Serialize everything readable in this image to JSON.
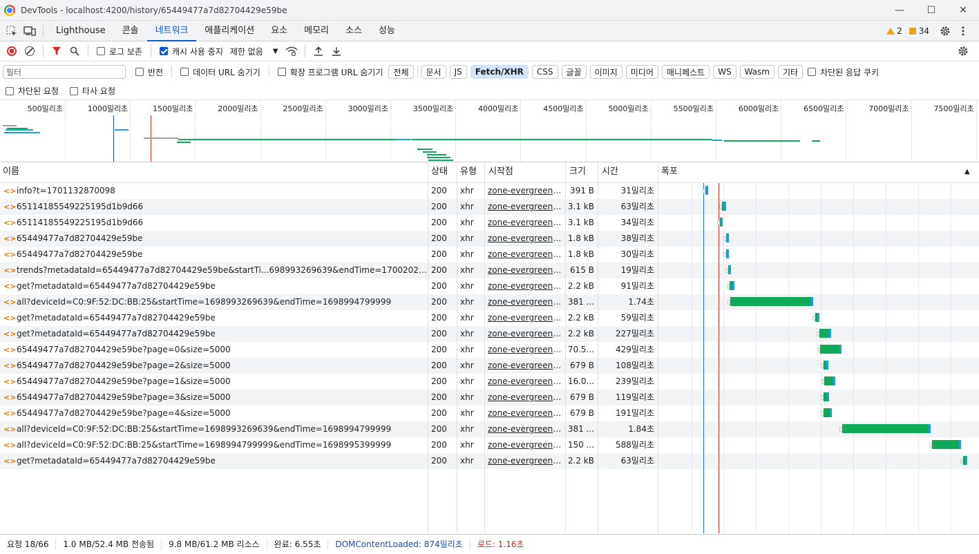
{
  "window": {
    "title": "DevTools - localhost:4200/history/65449477a7d82704429e59be",
    "minimize": "—",
    "maximize": "☐",
    "close": "✕"
  },
  "tabs": [
    {
      "label": "Lighthouse"
    },
    {
      "label": "콘솔"
    },
    {
      "label": "네트워크",
      "active": true
    },
    {
      "label": "애플리케이션"
    },
    {
      "label": "요소"
    },
    {
      "label": "메모리"
    },
    {
      "label": "소스"
    },
    {
      "label": "성능"
    }
  ],
  "counters": {
    "warnings": "2",
    "messages": "34"
  },
  "toolbar": {
    "preserve_log": "로그 보존",
    "disable_cache": "캐시 사용 중지",
    "throttle": "제한 없음"
  },
  "filter": {
    "placeholder": "필터",
    "invert": "반전",
    "hide_data_urls": "데이터 URL 숨기기",
    "hide_ext_urls": "확장 프로그램 URL 숨기기",
    "types": [
      "전체",
      "문서",
      "JS",
      "Fetch/XHR",
      "CSS",
      "글꼴",
      "이미지",
      "미디어",
      "매니페스트",
      "WS",
      "Wasm",
      "기타"
    ],
    "active_type": "Fetch/XHR",
    "blocked_cookies": "차단된 응답 쿠키",
    "blocked_requests": "차단된 요청",
    "third_party": "타사 요청"
  },
  "overview": {
    "ticks": [
      "500밀리초",
      "1000밀리초",
      "1500밀리초",
      "2000밀리초",
      "2500밀리초",
      "3000밀리초",
      "3500밀리초",
      "4000밀리초",
      "4500밀리초",
      "5000밀리초",
      "5500밀리초",
      "6000밀리초",
      "6500밀리초",
      "7000밀리초",
      "7500밀리초"
    ]
  },
  "columns": {
    "name": "이름",
    "status": "상태",
    "type": "유형",
    "initiator": "시작점",
    "size": "크기",
    "time": "시간",
    "waterfall": "폭포"
  },
  "rows": [
    {
      "name": "info?t=1701132870098",
      "status": "200",
      "type": "xhr",
      "initiator": "zone-evergreen.j...",
      "size": "391 B",
      "time": "31밀리초"
    },
    {
      "name": "65114185549225195d1b9d66",
      "status": "200",
      "type": "xhr",
      "initiator": "zone-evergreen.j...",
      "size": "3.1 kB",
      "time": "63밀리초"
    },
    {
      "name": "65114185549225195d1b9d66",
      "status": "200",
      "type": "xhr",
      "initiator": "zone-evergreen.j...",
      "size": "3.1 kB",
      "time": "34밀리초"
    },
    {
      "name": "65449477a7d82704429e59be",
      "status": "200",
      "type": "xhr",
      "initiator": "zone-evergreen.j...",
      "size": "1.8 kB",
      "time": "38밀리초"
    },
    {
      "name": "65449477a7d82704429e59be",
      "status": "200",
      "type": "xhr",
      "initiator": "zone-evergreen.j...",
      "size": "1.8 kB",
      "time": "30밀리초"
    },
    {
      "name": "trends?metadataId=65449477a7d82704429e59be&startTi...698993269639&endTime=17002028696...",
      "status": "200",
      "type": "xhr",
      "initiator": "zone-evergreen.j...",
      "size": "615 B",
      "time": "19밀리초"
    },
    {
      "name": "get?metadataId=65449477a7d82704429e59be",
      "status": "200",
      "type": "xhr",
      "initiator": "zone-evergreen.j...",
      "size": "2.2 kB",
      "time": "91밀리초"
    },
    {
      "name": "all?deviceId=C0:9F:52:DC:BB:25&startTime=1698993269639&endTime=1698994799999",
      "status": "200",
      "type": "xhr",
      "initiator": "zone-evergreen.j...",
      "size": "381 ...",
      "time": "1.74초"
    },
    {
      "name": "get?metadataId=65449477a7d82704429e59be",
      "status": "200",
      "type": "xhr",
      "initiator": "zone-evergreen.j...",
      "size": "2.2 kB",
      "time": "59밀리초"
    },
    {
      "name": "get?metadataId=65449477a7d82704429e59be",
      "status": "200",
      "type": "xhr",
      "initiator": "zone-evergreen.j...",
      "size": "2.2 kB",
      "time": "227밀리초"
    },
    {
      "name": "65449477a7d82704429e59be?page=0&size=5000",
      "status": "200",
      "type": "xhr",
      "initiator": "zone-evergreen.j...",
      "size": "70.5...",
      "time": "429밀리초"
    },
    {
      "name": "65449477a7d82704429e59be?page=2&size=5000",
      "status": "200",
      "type": "xhr",
      "initiator": "zone-evergreen.j...",
      "size": "679 B",
      "time": "108밀리초"
    },
    {
      "name": "65449477a7d82704429e59be?page=1&size=5000",
      "status": "200",
      "type": "xhr",
      "initiator": "zone-evergreen.j...",
      "size": "16.0...",
      "time": "239밀리초"
    },
    {
      "name": "65449477a7d82704429e59be?page=3&size=5000",
      "status": "200",
      "type": "xhr",
      "initiator": "zone-evergreen.j...",
      "size": "679 B",
      "time": "119밀리초"
    },
    {
      "name": "65449477a7d82704429e59be?page=4&size=5000",
      "status": "200",
      "type": "xhr",
      "initiator": "zone-evergreen.j...",
      "size": "679 B",
      "time": "191밀리초"
    },
    {
      "name": "all?deviceId=C0:9F:52:DC:BB:25&startTime=1698993269639&endTime=1698994799999",
      "status": "200",
      "type": "xhr",
      "initiator": "zone-evergreen.j...",
      "size": "381 ...",
      "time": "1.84초"
    },
    {
      "name": "all?deviceId=C0:9F:52:DC:BB:25&startTime=1698994799999&endTime=1698995399999",
      "status": "200",
      "type": "xhr",
      "initiator": "zone-evergreen.j...",
      "size": "150 ...",
      "time": "588밀리초"
    },
    {
      "name": "get?metadataId=65449477a7d82704429e59be",
      "status": "200",
      "type": "xhr",
      "initiator": "zone-evergreen.j...",
      "size": "2.2 kB",
      "time": "63밀리초"
    }
  ],
  "status": {
    "requests": "요청 18/66",
    "transferred": "1.0 MB/52.4 MB 전송됨",
    "resources": "9.8 MB/61.2 MB 리소스",
    "finish": "완료: 6.55초",
    "dcl": "DOMContentLoaded: 874밀리초",
    "load": "로드: 1.16초"
  },
  "colors": {
    "accent": "#0b57d0",
    "dcl": "#1a73e8",
    "load": "#d93025",
    "wf_green": "#0fa958",
    "wf_blue": "#1a9fe0"
  }
}
